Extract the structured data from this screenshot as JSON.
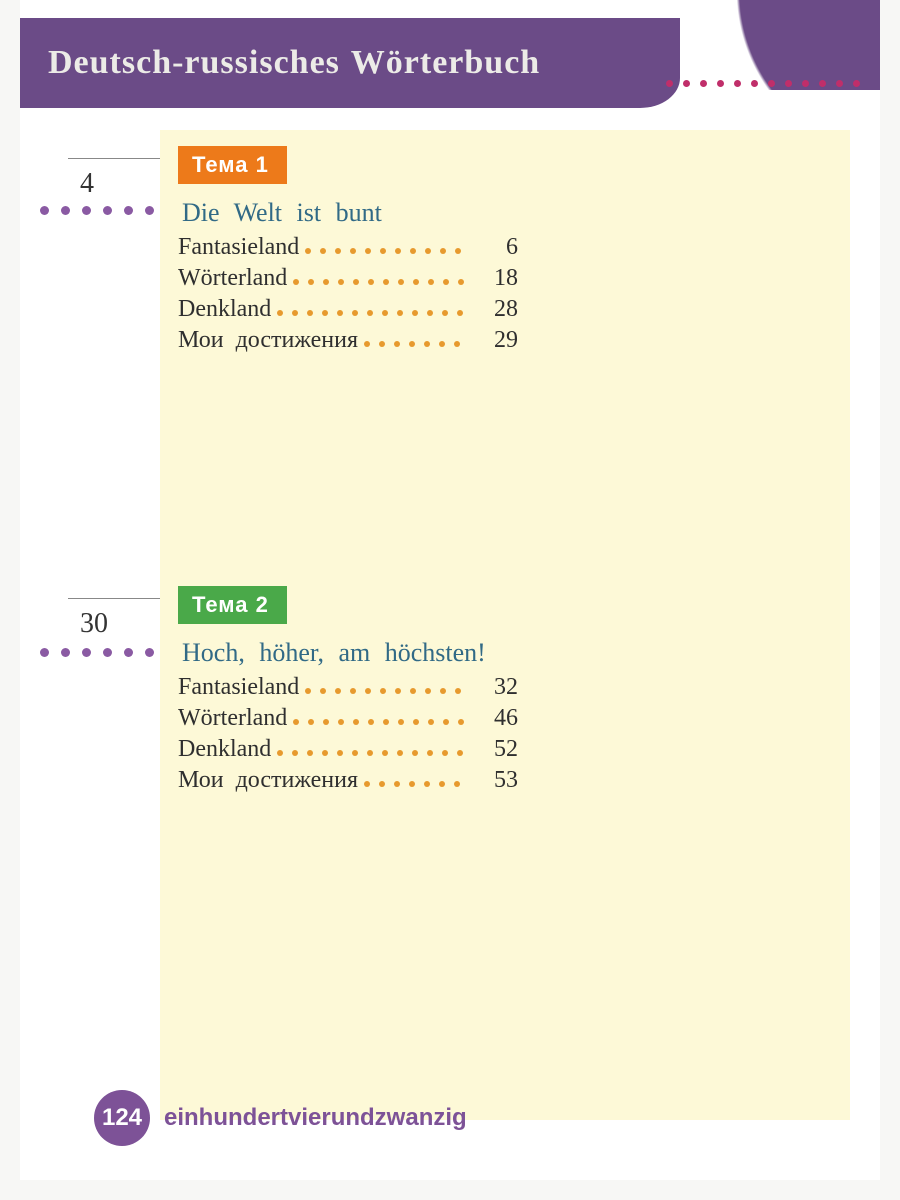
{
  "header": {
    "title": "Deutsch-russisches Wörterbuch"
  },
  "sections": [
    {
      "tag": "Тема  1",
      "side_page": "4",
      "title": "Die  Welt  ist  bunt",
      "items": [
        {
          "label": "Fantasieland",
          "page": "6"
        },
        {
          "label": "Wörterland",
          "page": "18"
        },
        {
          "label": "Denkland",
          "page": "28"
        },
        {
          "label": "Мои  достижения",
          "page": "29"
        }
      ]
    },
    {
      "tag": "Тема  2",
      "side_page": "30",
      "title": "Hoch,  höher,  am  höchsten!",
      "items": [
        {
          "label": "Fantasieland",
          "page": "32"
        },
        {
          "label": "Wörterland",
          "page": "46"
        },
        {
          "label": "Denkland",
          "page": "52"
        },
        {
          "label": "Мои  достижения",
          "page": "53"
        }
      ]
    }
  ],
  "footer": {
    "page_number": "124",
    "page_word": "einhundertvierundzwanzig"
  },
  "colors": {
    "purple": "#6b4b87",
    "orange_tag": "#ed7a1a",
    "green_tag": "#4aa949",
    "dot_orange": "#e79a2e",
    "dot_violet": "#8a5aa3",
    "dot_magenta": "#c02e6a",
    "panel_bg": "#fdf9d7"
  }
}
